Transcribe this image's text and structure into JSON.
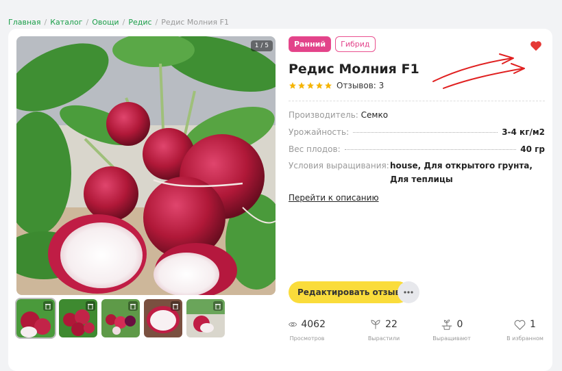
{
  "breadcrumb": [
    "Главная",
    "Каталог",
    "Овощи",
    "Редис",
    "Редис Молния F1"
  ],
  "gallery": {
    "counter": "1 / 5",
    "thumb_count": 5
  },
  "tags": [
    "Ранний",
    "Гибрид"
  ],
  "title": "Редис Молния F1",
  "rating": {
    "stars": 5,
    "reviews": "Отзывов: 3"
  },
  "properties": {
    "producer_label": "Производитель:",
    "producer_value": "Семко",
    "yield_label": "Урожайность:",
    "yield_value": "3-4 кг/м2",
    "weight_label": "Вес плодов:",
    "weight_value": "40 гр",
    "conditions_label": "Условия выращивания:",
    "conditions_value": "house, Для открытого грунта, Для теплицы"
  },
  "description_link": "Перейти к описанию",
  "actions": {
    "edit_review": "Редактировать отзыв",
    "more": "•••"
  },
  "stats": [
    {
      "icon": "eye-icon",
      "value": "4062",
      "label": "Просмотров"
    },
    {
      "icon": "sprout-icon",
      "value": "22",
      "label": "Вырастили"
    },
    {
      "icon": "seedling-pot-icon",
      "value": "0",
      "label": "Выращивают"
    },
    {
      "icon": "heart-outline-icon",
      "value": "1",
      "label": "В избранном"
    }
  ],
  "colors": {
    "accent_pink": "#e2438a",
    "link_green": "#1a9e48",
    "button_yellow": "#fadc3b",
    "favorite_red": "#e53935",
    "annotation_red": "#e02020"
  }
}
